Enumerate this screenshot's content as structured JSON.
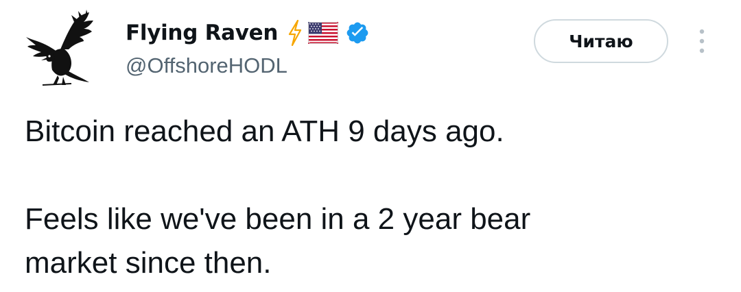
{
  "author": {
    "display_name": "Flying Raven",
    "handle": "@OffshoreHODL",
    "badges": [
      "lightning-icon",
      "us-flag-icon",
      "verified-icon"
    ]
  },
  "follow_button": {
    "label": "Читаю"
  },
  "more_icon": "more-vertical-icon",
  "tweet": {
    "line1": "Bitcoin reached an ATH 9 days ago.",
    "line2": "Feels like we've been in a 2 year bear",
    "line3": "market since then."
  },
  "colors": {
    "text": "#0f1419",
    "secondary": "#536471",
    "verified": "#1d9bf0",
    "lightning": "#f7a600",
    "border": "#cfd9de"
  }
}
